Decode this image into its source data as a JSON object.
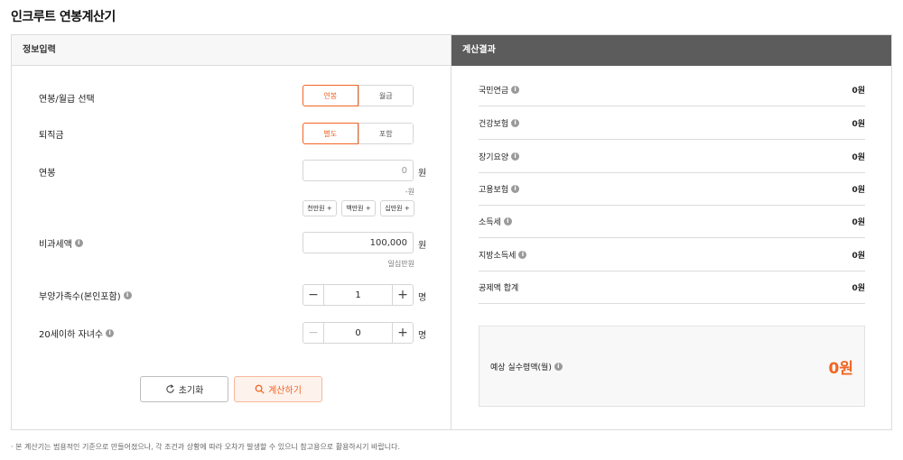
{
  "title": "인크루트 연봉계산기",
  "input_panel": {
    "header": "정보입력",
    "pay_type": {
      "label": "연봉/월급 선택",
      "options": [
        "연봉",
        "월급"
      ],
      "selected_index": 0
    },
    "severance": {
      "label": "퇴직금",
      "options": [
        "별도",
        "포함"
      ],
      "selected_index": 0
    },
    "salary": {
      "label": "연봉",
      "value": "0",
      "unit": "원",
      "hint": "-원",
      "quick_buttons": [
        "천만원 +",
        "백만원 +",
        "십만원 +"
      ]
    },
    "non_taxable": {
      "label": "비과세액",
      "value": "100,000",
      "unit": "원",
      "hint": "일십만원"
    },
    "dependents": {
      "label": "부양가족수(본인포함)",
      "value": "1",
      "unit": "명"
    },
    "children": {
      "label": "20세이하 자녀수",
      "value": "0",
      "unit": "명"
    },
    "reset_label": "초기화",
    "calc_label": "계산하기"
  },
  "result_panel": {
    "header": "계산결과",
    "rows": [
      {
        "label": "국민연금",
        "value": "0원",
        "info": true
      },
      {
        "label": "건강보험",
        "value": "0원",
        "info": true
      },
      {
        "label": "장기요양",
        "value": "0원",
        "info": true
      },
      {
        "label": "고용보험",
        "value": "0원",
        "info": true
      },
      {
        "label": "소득세",
        "value": "0원",
        "info": true
      },
      {
        "label": "지방소득세",
        "value": "0원",
        "info": true
      },
      {
        "label": "공제액 합계",
        "value": "0원",
        "info": false
      }
    ],
    "net_label": "예상 실수령액(월)",
    "net_value": "0원"
  },
  "footnote": "· 본 계산기는 범용적인 기준으로 만들어졌으나, 각 조건과 상황에 따라 오차가 발생할 수 있으니 참고용으로 활용하시기 바랍니다.",
  "colors": {
    "accent": "#f26522",
    "result_header": "#5c5c5c"
  }
}
